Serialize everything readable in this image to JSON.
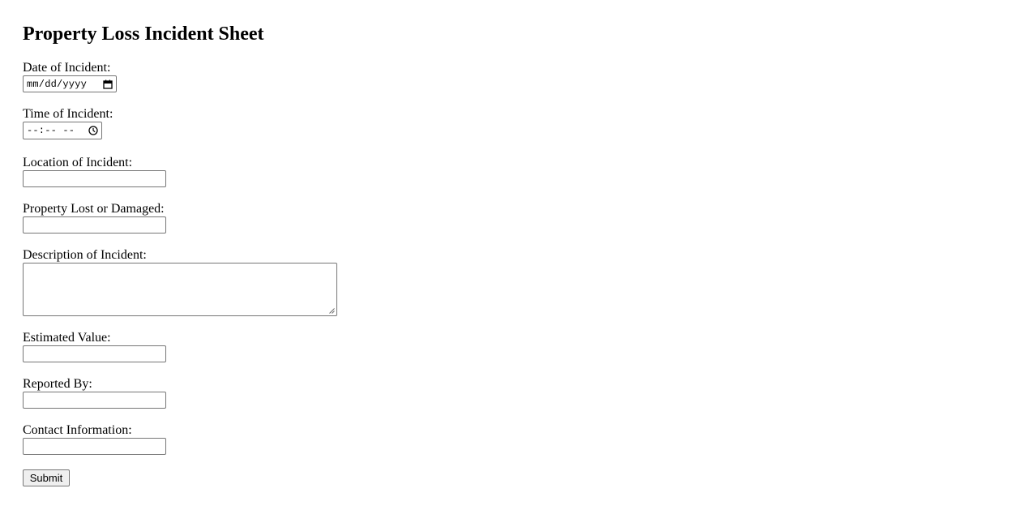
{
  "form": {
    "title": "Property Loss Incident Sheet",
    "fields": {
      "date": {
        "label": "Date of Incident:",
        "placeholder": "mm/dd/yyyy",
        "value": ""
      },
      "time": {
        "label": "Time of Incident:",
        "placeholder": "--:-- --",
        "value": ""
      },
      "location": {
        "label": "Location of Incident:",
        "value": ""
      },
      "property": {
        "label": "Property Lost or Damaged:",
        "value": ""
      },
      "description": {
        "label": "Description of Incident:",
        "value": ""
      },
      "estimated_value": {
        "label": "Estimated Value:",
        "value": ""
      },
      "reported_by": {
        "label": "Reported By:",
        "value": ""
      },
      "contact": {
        "label": "Contact Information:",
        "value": ""
      }
    },
    "submit_label": "Submit"
  },
  "icons": {
    "date": "calendar-icon",
    "time": "clock-icon"
  }
}
